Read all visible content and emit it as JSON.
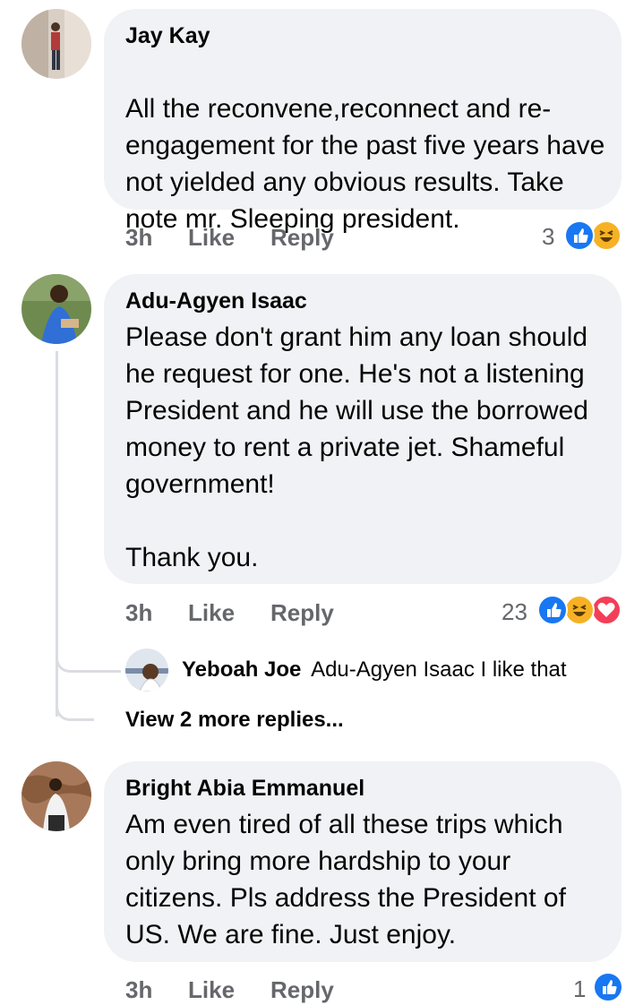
{
  "comments": [
    {
      "author": "Jay Kay",
      "text": "All the reconvene,reconnect and re-engagement for the past five years have not yielded any obvious results. Take note mr. Sleeping president.",
      "time": "3h",
      "like_label": "Like",
      "reply_label": "Reply",
      "reaction_count": "3",
      "reactions": [
        "like-icon",
        "haha-icon"
      ]
    },
    {
      "author": "Adu-Agyen Isaac",
      "text": "Please don't grant him any loan should he request for one. He's not a listening President and he will use the borrowed money to rent a private jet. Shameful government!\n\nThank you.",
      "time": "3h",
      "like_label": "Like",
      "reply_label": "Reply",
      "reaction_count": "23",
      "reactions": [
        "like-icon",
        "haha-icon",
        "love-icon"
      ],
      "reply": {
        "author": "Yeboah Joe",
        "text": "Adu-Agyen Isaac I like that"
      },
      "view_more": "View 2 more replies..."
    },
    {
      "author": "Bright Abia Emmanuel",
      "text": "Am even tired of all these trips which only bring more hardship to your citizens. Pls address the President of US. We are fine. Just enjoy.",
      "time": "3h",
      "like_label": "Like",
      "reply_label": "Reply",
      "reaction_count": "1",
      "reactions": [
        "like-icon"
      ]
    }
  ],
  "colors": {
    "bubble": "#f0f2f5",
    "meta": "#65676b",
    "like_blue": "#1877f2",
    "haha_yellow": "#f7b125",
    "love_red": "#f33e58"
  }
}
